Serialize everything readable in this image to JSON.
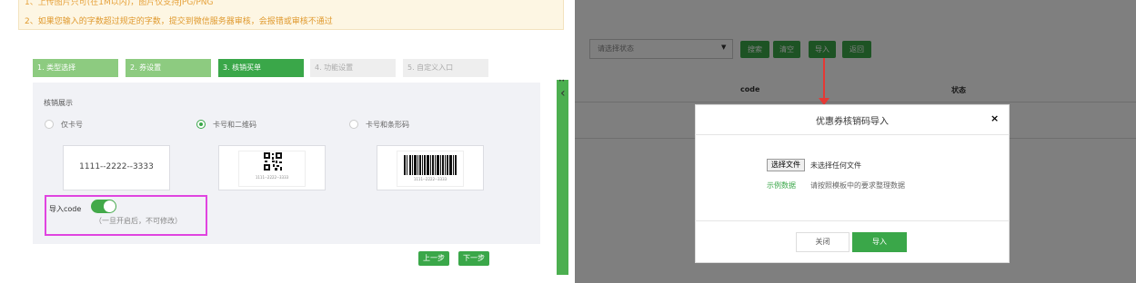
{
  "left": {
    "notice": {
      "line1": "1、上传图片只可(在1M以内)，图片仅支持JPG/PNG",
      "line2": "2、如果您输入的字数超过规定的字数，提交到微信服务器审核，会报错或审核不通过"
    },
    "steps": [
      {
        "label": "1. 类型选择",
        "state": "done"
      },
      {
        "label": "2. 券设置",
        "state": "done"
      },
      {
        "label": "3. 核销买单",
        "state": "active"
      },
      {
        "label": "4. 功能设置",
        "state": "todo"
      },
      {
        "label": "5. 自定义入口",
        "state": "todo"
      }
    ],
    "section_title": "核销展示",
    "radios": [
      {
        "label": "仅卡号",
        "selected": false
      },
      {
        "label": "卡号和二维码",
        "selected": true
      },
      {
        "label": "卡号和条形码",
        "selected": false
      }
    ],
    "cards": {
      "number_text": "1111--2222--3333",
      "qr_caption": "1111--2222--3333",
      "barcode_caption": "1111--2222--3333"
    },
    "import_code": {
      "label": "导入code",
      "enabled": true,
      "hint": "（一旦开启后，不可修改）"
    },
    "buttons": {
      "prev": "上一步",
      "next": "下一步"
    },
    "colors": {
      "accent": "#3aa749",
      "highlight_border": "#e044e0"
    }
  },
  "right": {
    "toolbar": {
      "status_placeholder": "请选择状态",
      "search": "搜索",
      "clear": "清空",
      "import": "导入",
      "back": "返回"
    },
    "table_headers": {
      "code": "code",
      "status": "状态"
    },
    "modal": {
      "title": "优惠券核销码导入",
      "close_symbol": "×",
      "file_button": "选择文件",
      "file_status": "未选择任何文件",
      "sample_link": "示例数据",
      "sample_hint": "请按照模板中的要求整理数据",
      "cancel": "关闭",
      "confirm": "导入"
    },
    "colors": {
      "annotation_arrow": "#e53935"
    }
  }
}
